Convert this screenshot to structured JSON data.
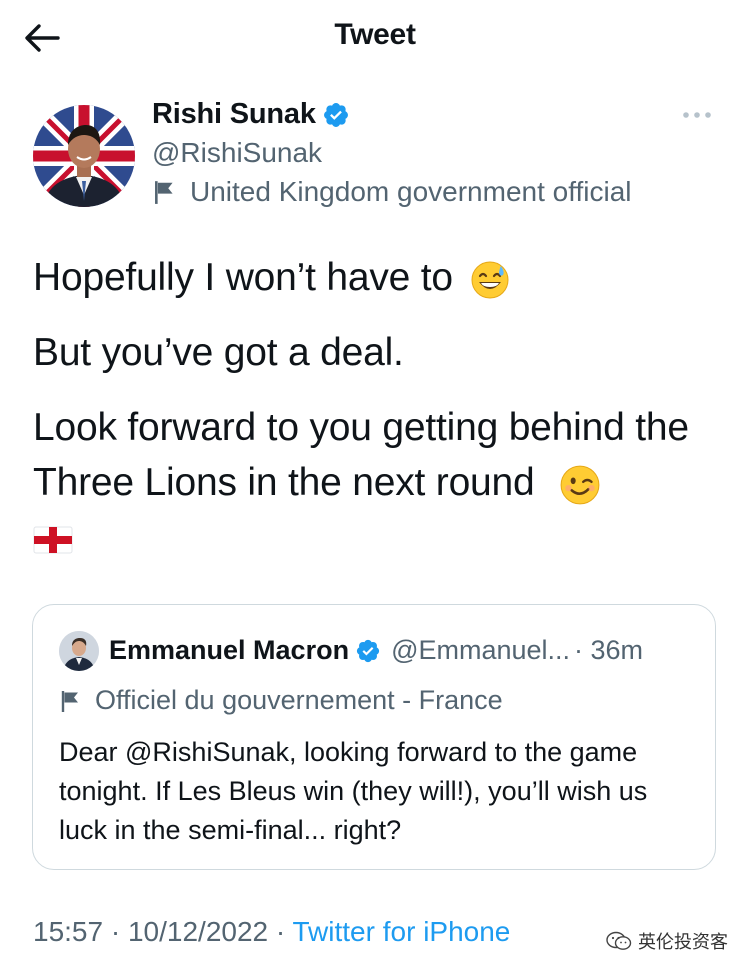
{
  "header": {
    "title": "Tweet"
  },
  "tweet": {
    "author_name": "Rishi Sunak",
    "author_handle": "@RishiSunak",
    "government_label": "United Kingdom government official",
    "lines": {
      "p1": "Hopefully I won’t have to",
      "p2": "But you’ve got a deal.",
      "p3": "Look forward to you getting behind the Three Lions in the next round"
    },
    "time": "15:57",
    "separator": "·",
    "date": "10/12/2022",
    "source": "Twitter for iPhone"
  },
  "quoted_tweet": {
    "author_name": "Emmanuel Macron",
    "author_handle": "@Emmanuel...",
    "age": "· 36m",
    "government_label": "Officiel du gouvernement - France",
    "text": "Dear @RishiSunak, looking forward to the game tonight. If Les Bleus win (they will!), you’ll wish us luck in the semi-final... right?"
  },
  "watermark": {
    "text": "英伦投资客"
  },
  "icons": {
    "back": "back-arrow-icon",
    "more": "more-options-icon",
    "verified": "verified-badge-icon",
    "government_flag": "government-flag-icon",
    "emoji_sweat": "grinning-sweat-emoji",
    "emoji_wink": "winking-emoji",
    "emoji_england": "england-flag-emoji"
  },
  "colors": {
    "text": "#0f1419",
    "secondary_text": "#536471",
    "link_blue": "#1d9bf0",
    "border": "#cfd9de",
    "verified_blue": "#1d9bf0"
  }
}
